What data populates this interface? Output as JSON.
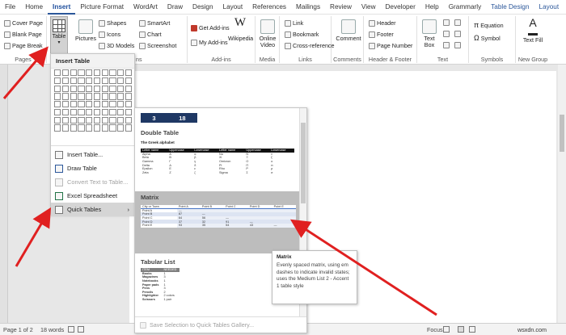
{
  "tabs": [
    "File",
    "Home",
    "Insert",
    "Picture Format",
    "WordArt",
    "Draw",
    "Design",
    "Layout",
    "References",
    "Mailings",
    "Review",
    "View",
    "Developer",
    "Help",
    "Grammarly",
    "Table Design",
    "Layout"
  ],
  "active_tab": "Insert",
  "ribbon": {
    "pages": {
      "items": [
        "Cover Page",
        "Blank Page",
        "Page Break"
      ],
      "label": "Pages"
    },
    "table_button": "Table",
    "illustrations": {
      "pictures": "Pictures",
      "shapes": "Shapes",
      "icons": "Icons",
      "models": "3D Models",
      "smartart": "SmartArt",
      "chart": "Chart",
      "screenshot": "Screenshot",
      "label": "ns"
    },
    "addins": {
      "get": "Get Add-ins",
      "my": "My Add-ins",
      "wikipedia": "Wikipedia",
      "label": "Add-ins"
    },
    "media": {
      "online_video": "Online Video",
      "label": "Media"
    },
    "links": {
      "link": "Link",
      "bookmark": "Bookmark",
      "cross_reference": "Cross-reference",
      "label": "Links"
    },
    "comments": {
      "comment": "Comment",
      "label": "Comments"
    },
    "header_footer": {
      "header": "Header",
      "footer": "Footer",
      "page_number": "Page Number",
      "label": "Header & Footer"
    },
    "text": {
      "text_box": "Text Box",
      "label": "Text"
    },
    "symbols": {
      "equation": "Equation",
      "symbol": "Symbol",
      "label": "Symbols"
    },
    "new_group": {
      "text_fill": "Text Fill",
      "label": "New Group"
    }
  },
  "table_menu": {
    "header": "Insert Table",
    "grid_rows": 8,
    "grid_cols": 10,
    "items": [
      {
        "label": "Insert Table...",
        "disabled": false
      },
      {
        "label": "Draw Table",
        "disabled": false
      },
      {
        "label": "Convert Text to Table...",
        "disabled": true
      },
      {
        "label": "Excel Spreadsheet",
        "disabled": false
      },
      {
        "label": "Quick Tables",
        "disabled": false,
        "submenu": true
      }
    ]
  },
  "gallery": {
    "calendar": [
      "3",
      "18"
    ],
    "double_table": {
      "title": "Double Table",
      "subtitle": "The Greek alphabet",
      "headers": [
        "Letter name",
        "Uppercase",
        "Lowercase",
        "Letter name",
        "Uppercase",
        "Lowercase"
      ],
      "rows": [
        [
          "Alpha",
          "A",
          "α",
          "Nu",
          "N",
          "ν"
        ],
        [
          "Beta",
          "B",
          "β",
          "Xi",
          "Ξ",
          "ξ"
        ],
        [
          "Gamma",
          "Γ",
          "γ",
          "Omicron",
          "O",
          "ο"
        ],
        [
          "Delta",
          "Δ",
          "δ",
          "Pi",
          "Π",
          "π"
        ],
        [
          "Epsilon",
          "E",
          "ε",
          "Rho",
          "P",
          "ρ"
        ],
        [
          "Zeta",
          "Z",
          "ζ",
          "Sigma",
          "Σ",
          "σ"
        ]
      ]
    },
    "matrix": {
      "title": "Matrix",
      "headers": [
        "City or Town",
        "Point A",
        "Point B",
        "Point C",
        "Point D",
        "Point E"
      ],
      "rows": [
        [
          "Point A",
          "—",
          "",
          "",
          "",
          ""
        ],
        [
          "Point B",
          "87",
          "—",
          "",
          "",
          ""
        ],
        [
          "Point C",
          "64",
          "56",
          "—",
          "",
          ""
        ],
        [
          "Point D",
          "37",
          "32",
          "91",
          "—",
          ""
        ],
        [
          "Point E",
          "93",
          "35",
          "54",
          "43",
          "—"
        ]
      ]
    },
    "tabular_list": {
      "title": "Tabular List",
      "headers": [
        "ITEM",
        "NEEDED"
      ],
      "rows": [
        [
          "Books",
          "1"
        ],
        [
          "Magazines",
          "3"
        ],
        [
          "Notebooks",
          "1"
        ],
        [
          "Paper pads",
          "1"
        ],
        [
          "Pens",
          "3"
        ],
        [
          "Pencils",
          "2"
        ],
        [
          "Highlighter",
          "2 colors"
        ],
        [
          "Scissors",
          "1 pair"
        ]
      ]
    },
    "footer": "Save Selection to Quick Tables Gallery..."
  },
  "tooltip": {
    "title": "Matrix",
    "body": "Evenly spaced matrix, using em dashes to indicate invalid states; uses the Medium List 2 - Accent 1 table style"
  },
  "status": {
    "page": "Page 1 of 2",
    "words": "18 words",
    "focus": "Focus",
    "brand": "wsxdn.com"
  },
  "colors": {
    "accent": "#2b579a",
    "arrow": "#e02020",
    "calendar": "#1f3864"
  }
}
